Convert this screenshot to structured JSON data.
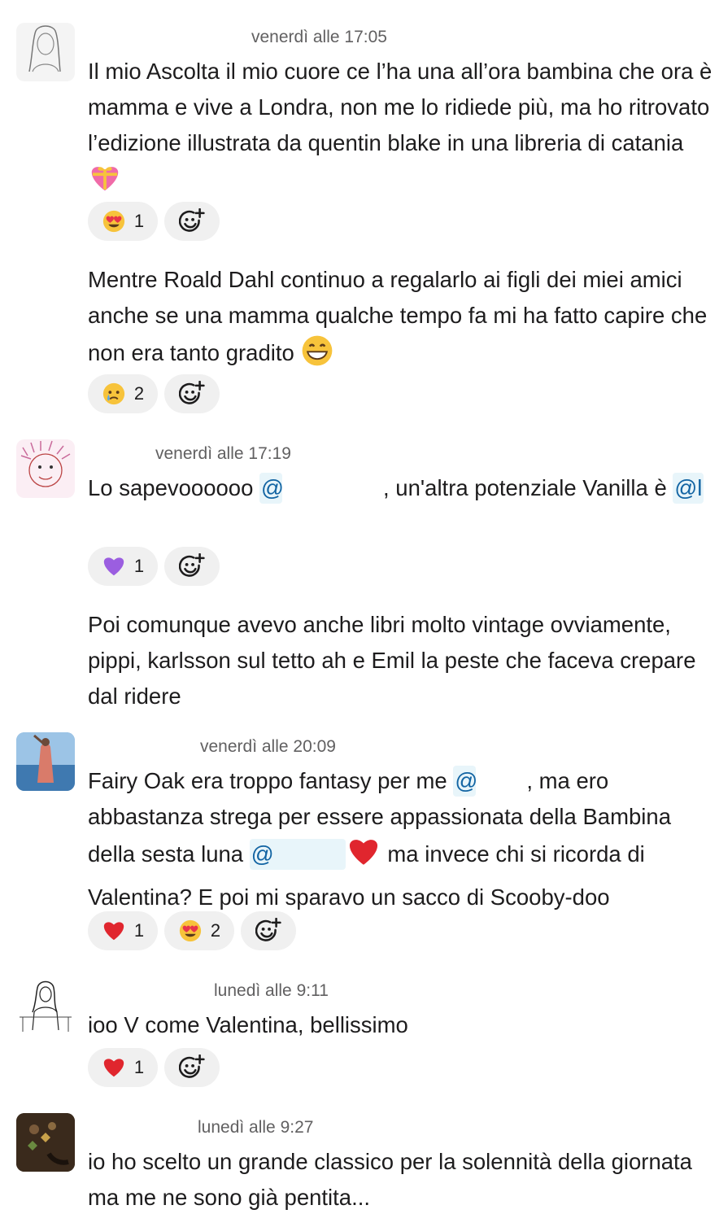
{
  "messages": [
    {
      "timestamp": "venerdì alle 17:05",
      "avatar": "sketch-woman-avatar",
      "posts": [
        {
          "text": "Il mio Ascolta il mio cuore ce l’ha una all’ora bambina che ora è mamma e vive a Londra, non me lo ridiede più, ma ho ritrovato l’edizione illustrata da quentin blake in una libreria di catania",
          "emoji": "gift-heart",
          "reactions": [
            {
              "emoji": "heart-eyes",
              "count": "1"
            }
          ]
        },
        {
          "text": "Mentre Roald Dahl continuo a regalarlo ai figli dei miei amici anche se una mamma qualche tempo fa mi ha fatto capire che non era tanto gradito",
          "emoji": "grin",
          "reactions": [
            {
              "emoji": "crying-face",
              "count": "2"
            }
          ]
        }
      ]
    },
    {
      "timestamp": "venerdì alle 17:19",
      "avatar": "child-drawing-avatar",
      "posts": [
        {
          "text_a": "Lo sapevoooooo ",
          "mention_a": "@",
          "text_b": ", un'altra potenziale Vanilla è ",
          "mention_b": "@l",
          "reactions": [
            {
              "emoji": "purple-heart",
              "count": "1"
            }
          ]
        },
        {
          "text": "Poi comunque avevo anche libri molto vintage ovviamente, pippi, karlsson sul tetto ah e Emil la peste che faceva crepare dal ridere"
        }
      ]
    },
    {
      "timestamp": "venerdì alle 20:09",
      "avatar": "beach-photo-avatar",
      "posts": [
        {
          "text_a": "Fairy Oak era troppo fantasy per me ",
          "mention_a": "@",
          "text_b": ", ma ero abbastanza strega per essere appassionata della Bambina della sesta luna ",
          "mention_b": "@",
          "text_c": " ma invece chi si ricorda di Valentina? E poi mi sparavo un sacco di Scooby-doo",
          "emoji": "red-heart",
          "reactions": [
            {
              "emoji": "red-heart",
              "count": "1"
            },
            {
              "emoji": "heart-eyes",
              "count": "2"
            }
          ]
        }
      ]
    },
    {
      "timestamp": "lunedì alle 9:11",
      "avatar": "line-drawing-avatar",
      "posts": [
        {
          "text": "ioo V come Valentina, bellissimo",
          "reactions": [
            {
              "emoji": "red-heart",
              "count": "1"
            }
          ]
        }
      ]
    },
    {
      "timestamp": "lunedì alle 9:27",
      "avatar": "flowers-photo-avatar",
      "posts": [
        {
          "text": "io ho scelto un grande classico per la solennità della giornata ma me ne sono già pentita..."
        }
      ]
    }
  ],
  "colors": {
    "text": "#1d1c1d",
    "timestamp": "#616061",
    "mention": "#1264a3",
    "mention_bg": "#e8f5fa",
    "reaction_bg": "#f0f0f0"
  }
}
